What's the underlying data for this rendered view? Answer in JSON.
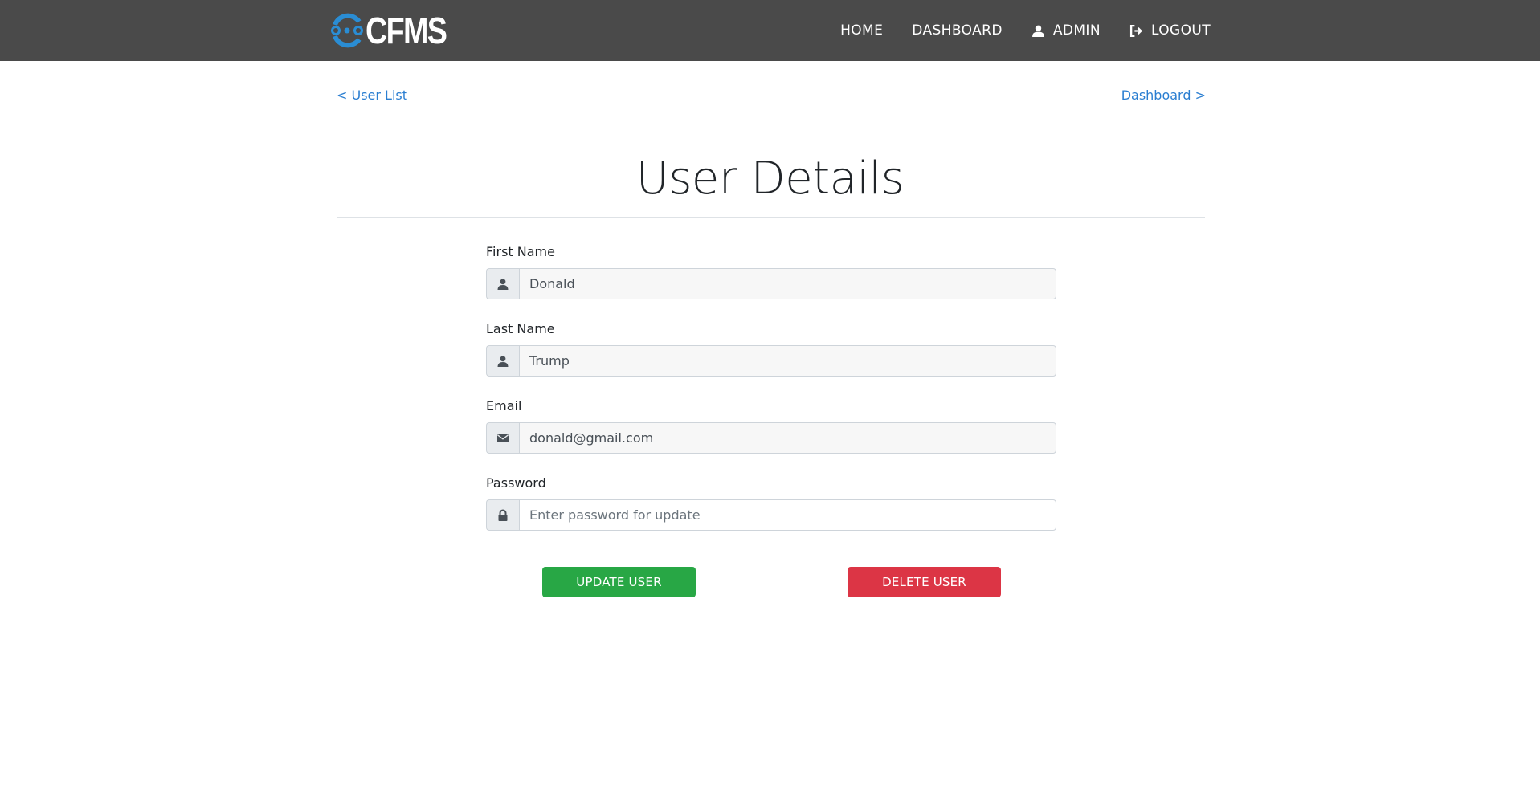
{
  "brand": {
    "name": "CFMS",
    "accent": "#2a8dd4"
  },
  "nav": {
    "home": "HOME",
    "dashboard": "DASHBOARD",
    "admin": "ADMIN",
    "logout": "LOGOUT"
  },
  "breadcrumbs": {
    "back": "< User List",
    "forward": "Dashboard >"
  },
  "page": {
    "title": "User Details"
  },
  "form": {
    "first_name": {
      "label": "First Name",
      "value": "Donald",
      "icon": "user-icon"
    },
    "last_name": {
      "label": "Last Name",
      "value": "Trump",
      "icon": "user-icon"
    },
    "email": {
      "label": "Email",
      "value": "donald@gmail.com",
      "icon": "envelope-icon"
    },
    "password": {
      "label": "Password",
      "value": "",
      "placeholder": "Enter password for update",
      "icon": "lock-icon"
    }
  },
  "actions": {
    "update": "UPDATE USER",
    "delete": "DELETE USER"
  },
  "colors": {
    "navbar": "#4a4a4a",
    "link": "#2a7ed1",
    "success": "#28a745",
    "danger": "#dc3545"
  }
}
